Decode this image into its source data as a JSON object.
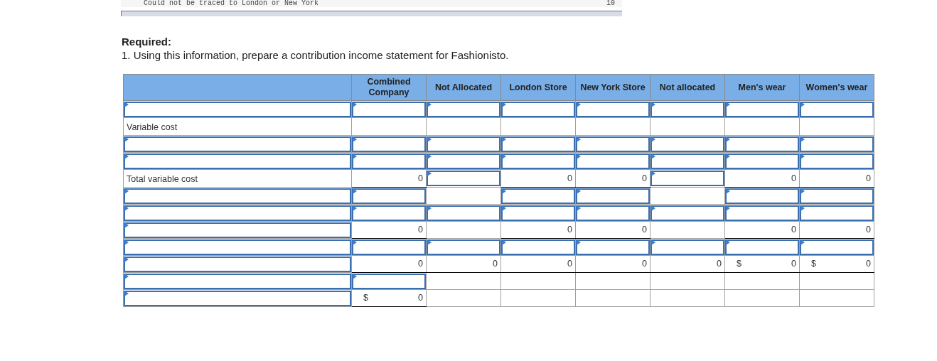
{
  "top_strip": {
    "text": "Could not be traced to London or New York",
    "value": "10"
  },
  "heading": "Required:",
  "instruction": "1. Using this information, prepare a contribution income statement for Fashionisto.",
  "table": {
    "columns": [
      "",
      "Combined Company",
      "Not Allocated",
      "London Store",
      "New York Store",
      "Not allocated",
      "Men's wear",
      "Women's wear"
    ],
    "rows": [
      [
        {
          "kind": "input"
        },
        {
          "kind": "input"
        },
        {
          "kind": "input"
        },
        {
          "kind": "input"
        },
        {
          "kind": "input"
        },
        {
          "kind": "input"
        },
        {
          "kind": "input"
        },
        {
          "kind": "input"
        }
      ],
      [
        {
          "kind": "label",
          "text": "Variable cost"
        },
        {
          "kind": "blank"
        },
        {
          "kind": "blank"
        },
        {
          "kind": "blank"
        },
        {
          "kind": "blank"
        },
        {
          "kind": "blank"
        },
        {
          "kind": "blank"
        },
        {
          "kind": "blank"
        }
      ],
      [
        {
          "kind": "input"
        },
        {
          "kind": "input"
        },
        {
          "kind": "input"
        },
        {
          "kind": "input"
        },
        {
          "kind": "input"
        },
        {
          "kind": "input"
        },
        {
          "kind": "input"
        },
        {
          "kind": "input"
        }
      ],
      [
        {
          "kind": "input"
        },
        {
          "kind": "input"
        },
        {
          "kind": "input"
        },
        {
          "kind": "input"
        },
        {
          "kind": "input"
        },
        {
          "kind": "input"
        },
        {
          "kind": "input"
        },
        {
          "kind": "input"
        }
      ],
      [
        {
          "kind": "label",
          "text": "Total variable cost"
        },
        {
          "kind": "amount",
          "text": "0"
        },
        {
          "kind": "input"
        },
        {
          "kind": "amount",
          "text": "0"
        },
        {
          "kind": "amount",
          "text": "0"
        },
        {
          "kind": "input"
        },
        {
          "kind": "amount",
          "text": "0"
        },
        {
          "kind": "amount",
          "text": "0"
        }
      ],
      [
        {
          "kind": "input"
        },
        {
          "kind": "input"
        },
        {
          "kind": "blank"
        },
        {
          "kind": "input"
        },
        {
          "kind": "input"
        },
        {
          "kind": "blank"
        },
        {
          "kind": "input"
        },
        {
          "kind": "input"
        }
      ],
      [
        {
          "kind": "input"
        },
        {
          "kind": "input"
        },
        {
          "kind": "input"
        },
        {
          "kind": "input"
        },
        {
          "kind": "input"
        },
        {
          "kind": "input"
        },
        {
          "kind": "input"
        },
        {
          "kind": "input"
        }
      ],
      [
        {
          "kind": "input"
        },
        {
          "kind": "amount",
          "text": "0"
        },
        {
          "kind": "blank"
        },
        {
          "kind": "amount",
          "text": "0"
        },
        {
          "kind": "amount",
          "text": "0"
        },
        {
          "kind": "blank"
        },
        {
          "kind": "amount",
          "text": "0"
        },
        {
          "kind": "amount",
          "text": "0"
        }
      ],
      [
        {
          "kind": "input"
        },
        {
          "kind": "input"
        },
        {
          "kind": "input"
        },
        {
          "kind": "input"
        },
        {
          "kind": "input"
        },
        {
          "kind": "input"
        },
        {
          "kind": "input"
        },
        {
          "kind": "input"
        }
      ],
      [
        {
          "kind": "input"
        },
        {
          "kind": "amount",
          "text": "0"
        },
        {
          "kind": "amount",
          "text": "0"
        },
        {
          "kind": "amount",
          "text": "0"
        },
        {
          "kind": "amount",
          "text": "0"
        },
        {
          "kind": "amount",
          "text": "0"
        },
        {
          "kind": "amount",
          "prefix": "$",
          "text": "0"
        },
        {
          "kind": "amount",
          "prefix": "$",
          "text": "0"
        }
      ],
      [
        {
          "kind": "input"
        },
        {
          "kind": "input"
        },
        {
          "kind": "blank"
        },
        {
          "kind": "blank"
        },
        {
          "kind": "blank"
        },
        {
          "kind": "blank"
        },
        {
          "kind": "blank"
        },
        {
          "kind": "blank"
        }
      ],
      [
        {
          "kind": "input"
        },
        {
          "kind": "amount",
          "prefix": "$",
          "text": "0"
        },
        {
          "kind": "blank"
        },
        {
          "kind": "blank"
        },
        {
          "kind": "blank"
        },
        {
          "kind": "blank"
        },
        {
          "kind": "blank"
        },
        {
          "kind": "blank"
        }
      ]
    ]
  }
}
